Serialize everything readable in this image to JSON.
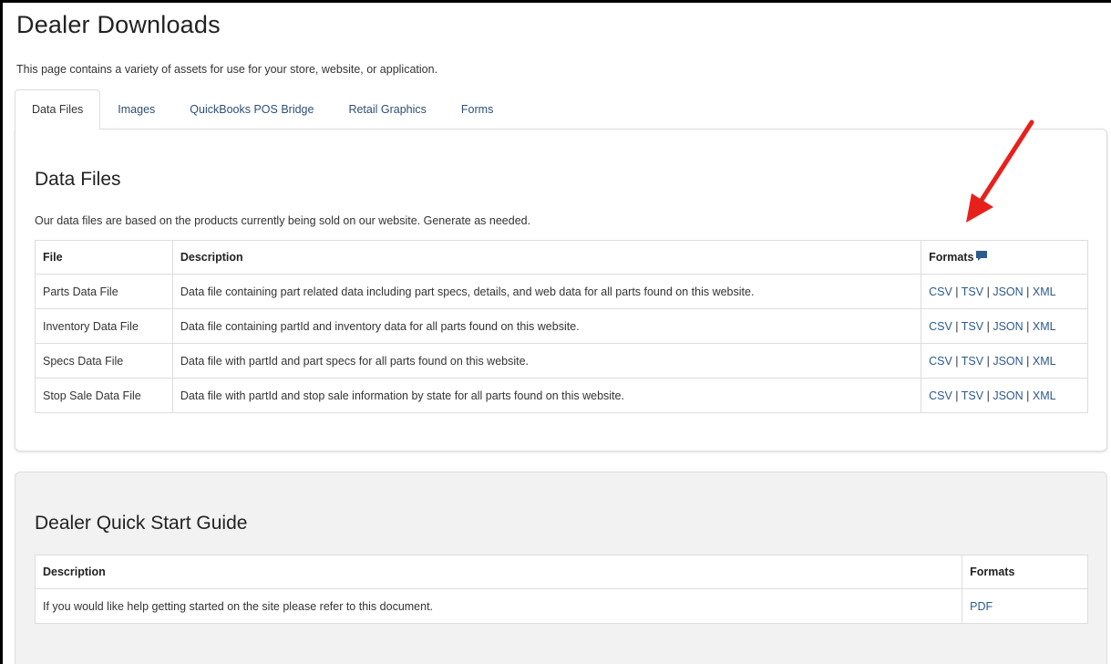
{
  "page": {
    "title": "Dealer Downloads",
    "intro": "This page contains a variety of assets for use for your store, website, or application."
  },
  "tabs": [
    {
      "label": "Data Files",
      "active": true
    },
    {
      "label": "Images",
      "active": false
    },
    {
      "label": "QuickBooks POS Bridge",
      "active": false
    },
    {
      "label": "Retail Graphics",
      "active": false
    },
    {
      "label": "Forms",
      "active": false
    }
  ],
  "data_files": {
    "title": "Data Files",
    "intro": "Our data files are based on the products currently being sold on our website. Generate as needed.",
    "headers": {
      "file": "File",
      "description": "Description",
      "formats": "Formats"
    },
    "formats_icon": "comment-icon",
    "rows": [
      {
        "file": "Parts Data File",
        "description": "Data file containing part related data including part specs, details, and web data for all parts found on this website.",
        "formats": [
          "CSV",
          "TSV",
          "JSON",
          "XML"
        ]
      },
      {
        "file": "Inventory Data File",
        "description": "Data file containing partId and inventory data for all parts found on this website.",
        "formats": [
          "CSV",
          "TSV",
          "JSON",
          "XML"
        ]
      },
      {
        "file": "Specs Data File",
        "description": "Data file with partId and part specs for all parts found on this website.",
        "formats": [
          "CSV",
          "TSV",
          "JSON",
          "XML"
        ]
      },
      {
        "file": "Stop Sale Data File",
        "description": "Data file with partId and stop sale information by state for all parts found on this website.",
        "formats": [
          "CSV",
          "TSV",
          "JSON",
          "XML"
        ]
      }
    ],
    "separator": "|"
  },
  "quick_start": {
    "title": "Dealer Quick Start Guide",
    "headers": {
      "description": "Description",
      "formats": "Formats"
    },
    "rows": [
      {
        "description": "If you would like help getting started on the site please refer to this document.",
        "formats": [
          "PDF"
        ]
      }
    ]
  },
  "colors": {
    "link": "#2d5a8c",
    "tab_link": "#2d4f73",
    "arrow": "#e8201c",
    "border": "#dddddd",
    "guide_bg": "#f2f2f2",
    "icon": "#2d5a8c"
  }
}
